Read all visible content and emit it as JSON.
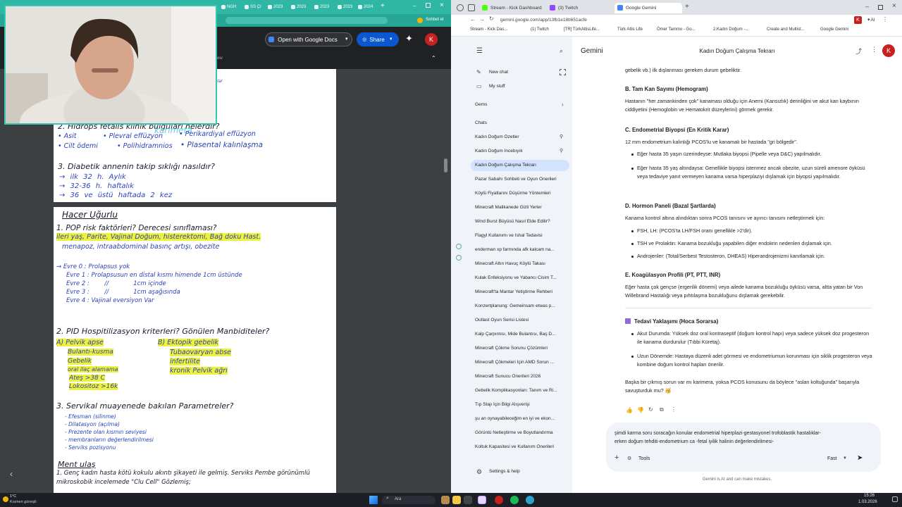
{
  "left_browser": {
    "tabs": [
      "NGH",
      "SS ÇI",
      "2023",
      "2023",
      "2023",
      "2023",
      "2024"
    ],
    "address_right": "Sohbet et",
    "open_with_label": "Open with Google Docs",
    "share_label": "Share",
    "avatar_letter": "K",
    "partial_text_1": "ew",
    "partial_text_2": "Var",
    "watermark": "karimeta"
  },
  "note_page_1": {
    "q2": "2. Hidrops fetalis klinik bulguları nelerdir?",
    "q2_items": [
      "• Asit",
      "• Plevral effüzyon",
      "• Perikardiyal effüzyon",
      "• Cilt ödemi",
      "• Polihidramnios",
      "• Plasental kalınlaşma"
    ],
    "q3": "3. Diabetik annenin takip sıklığı nasıldır?",
    "q3_items": [
      "→ ilk 32 h.  Aylık",
      "→ 32-36 h.  haftalık",
      "→ 36 ve üstü  haftada 2 kez"
    ]
  },
  "note_page_2": {
    "title": "Hacer Uğurlu",
    "q1": "1. POP risk faktörleri? Derecesi sınıflaması?",
    "q1_line1": "ileri yaş, Parite, Vajinal Doğum, histerektomi, Bağ doku Hast.",
    "q1_line2": "menapoz, intraabdominal basınç artışı, obezite",
    "stages": [
      "→ Evre 0 : Prolapsus yok",
      "Evre 1 : Prolapsusun en distal kısmı himende 1cm üstünde",
      "Evre 2 :        //             1cm içinde",
      "Evre 3 :        //             1cm aşağısında",
      "Evre 4 : Vajinal eversiyon Var"
    ],
    "q2": "2. PID Hospitilizasyon kriterleri? Gönülen Manbiditeler?",
    "q2_a": [
      "A) Pelvik apse",
      "Bulantı-kusma",
      "Gebelik",
      "oral ilaç alamama",
      "Ateş >38 C",
      "Lokositoz >16k"
    ],
    "q2_b": [
      "B) Ektopik gebelik",
      "Tubaovaryan abse",
      "infertilite",
      "kronik Pelvik ağrı"
    ],
    "q3": "3. Servikal muayenede bakılan Parametreler?",
    "q3_items": [
      "- Efesman (silinme)",
      "- Dilatasyon (açılma)",
      "- Prezente olan kısmın seviyesi",
      "- membranların değerlendirilmesi",
      "- Serviks pozisyonu"
    ],
    "next_title": "Ment ulaş",
    "next_line1": "1. Genç kadın hasta kötü kokulu akıntı şikayeti ile gelmiş. Serviks Pembe görünümlü",
    "next_line2": "mikroskobik incelemede \"Clu Cell\" Gözlemiş;"
  },
  "right_browser": {
    "tabs": [
      "Stream - Kick Dashboard",
      "(3) Twitch",
      "Google Gemini"
    ],
    "url": "gemini.google.com/app/13fb1e18b651acfe",
    "avatar_letter": "K",
    "bookmarks": [
      "Stream - Kick Das...",
      "(1) Twitch",
      "[TR] TürkAltisLife...",
      "Türk Altis Life",
      "Ömer Tammo - Go...",
      "2.Kadın Doğum -...",
      "Create and Multist...",
      "Google Gemini"
    ]
  },
  "gemini": {
    "brand": "Gemini",
    "conversation_title": "Kadın Doğum Çalışma Tekrarı",
    "new_chat": "New chat",
    "my_stuff": "My stuff",
    "gems": "Gems",
    "chats_label": "Chats",
    "chats": [
      "Kadın Doğum Özetler",
      "Kadın Doğum İncebıyık",
      "Kadın Doğum Çalışma Tekrarı",
      "Pazar Sabahı Sohbeti ve Oyun Önerileri",
      "Köylü Fiyatlarını Düşürme Yöntemleri",
      "Minecraft Malikanede Gizli Yerler",
      "Wind Burst Büyüsü Nasıl Elde Edilir?",
      "Flagyl Kullanımı ve İshal Tedavisi",
      "enderman xp farmında afk kalcam na...",
      "Minecraft Altın Havuç Köylü Takası",
      "Kulak Enfeksiyonu ve Yabancı Cisim T...",
      "Minecraft'ta Mantar Yetiştirme Rehberi",
      "Konzertplanung: Gemeinsam etwas p...",
      "Outlast Oyun Serisi Listesi",
      "Kalp Çarpıntısı, Mide Bulantısı, Baş D...",
      "Minecraft Çökme Sorunu Çözümleri",
      "Minecraft Çökmeleri İçin AMD Sorun ...",
      "Minecraft Sunucu Önerileri 2026",
      "Gebelik Komplikasyonları: Tanım ve Ri...",
      "Tıp Stajı İçin Bilgi Alışverişi",
      "şu an oynayabileceğim en iyi ve ekon...",
      "Görüntü Netleştirme ve Boyutlandırma",
      "Koltuk Kapasitesi ve Kullanım Önerileri"
    ],
    "settings": "Settings & help",
    "top_text": "gebelik vb.) ilk dışlanması gereken durum gebeliktir.",
    "sec_b_title": "B. Tam Kan Sayımı (Hemogram)",
    "sec_b_text": "Hastanın \"her zamankinden çok\" kanaması olduğu için Anemi (Kansızlık) derinliğini ve akut kan kaybının ciddiyetini (Hemoglobin ve Hematokrit düzeylerini) görmek gerekir.",
    "sec_c_title": "C. Endometrial Biyopsi (En Kritik Karar)",
    "sec_c_text": "12 mm endometrium kalınlığı PCOS'lu ve kanamalı bir hastada \"gri bölgedir\".",
    "sec_c_b1": "Eğer hasta 35 yaşın üzerindeyse: Mutlaka biyopsi (Pipelle veya D&C) yapılmalıdır.",
    "sec_c_b2": "Eğer hasta 35 yaş altındaysa: Genellikle biyopsi istenmez ancak obezite, uzun süreli amenore öyküsü veya tedaviye yanıt vermeyen kanama varsa hiperplaziyi dışlamak için biyopsi yapılmalıdır.",
    "sec_d_title": "D. Hormon Paneli (Bazal Şartlarda)",
    "sec_d_text": "Kanama kontrol altına alındıktan sonra PCOS tanısını ve ayırıcı tanısını netleştirmek için:",
    "sec_d_b1": "FSH, LH: (PCOS'ta LH/FSH oranı genellikle >2'dir).",
    "sec_d_b2": "TSH ve Prolaktin: Kanama bozukluğu yapabilen diğer endokrin nedenleri dışlamak için.",
    "sec_d_b3": "Androjenler: (Total/Serbest Testosteron, DHEAS) Hiperandrojenizmi kanıtlamak için.",
    "sec_e_title": "E. Koagülasyon Profili (PT, PTT, INR)",
    "sec_e_text": "Eğer hasta çok gençse (ergenlik dönemi) veya ailede kanama bozukluğu öyküsü varsa, altta yatan bir Von Willebrand Hastalığı veya pıhtılaşma bozukluğunu dışlamak gerekebilir.",
    "treat_title": "Tedavi Yaklaşımı (Hoca Sorarsa)",
    "treat_b1": "Akut Durumda: Yüksek doz oral kontraseptif (doğum kontrol hapı) veya sadece yüksek doz progesteron ile kanama durdurulur (Tıbbi Küretaj).",
    "treat_b2": "Uzun Dönemde: Hastaya düzenli adet görmesi ve endometriumun korunması için siklik progesteron veya kombine doğum kontrol hapları önerilir.",
    "closing": "Başka bir çıkmış sorun var mı karimera, yoksa PCOS konusunu da böylece \"aslan koltuğunda\" başarıyla savuşturduk mu? 🥳",
    "input_line1": "şimdi karma soru soracağın konular endometrial hiperplazi-gestasyonel trofoblastik hastalıklar-",
    "input_line2": "erken doğum tehditi-endometrium ca -fetal iyilik halinin değerlendirilmesi-",
    "tools_label": "Tools",
    "mode_label": "Fast",
    "disclaimer": "Gemini is AI and can make mistakes."
  },
  "taskbar": {
    "weather_temp": "1°C",
    "weather_desc": "Kısmen güneşli",
    "search_label": "Ara",
    "time": "15:26",
    "date": "1.03.2026"
  },
  "colors": {
    "teal": "#2fb6a4",
    "gemini_sidebar": "#f0f4f9",
    "active_chat": "#d3e3fd",
    "highlight": "#eef23a",
    "note_blue": "#2a43b8"
  }
}
